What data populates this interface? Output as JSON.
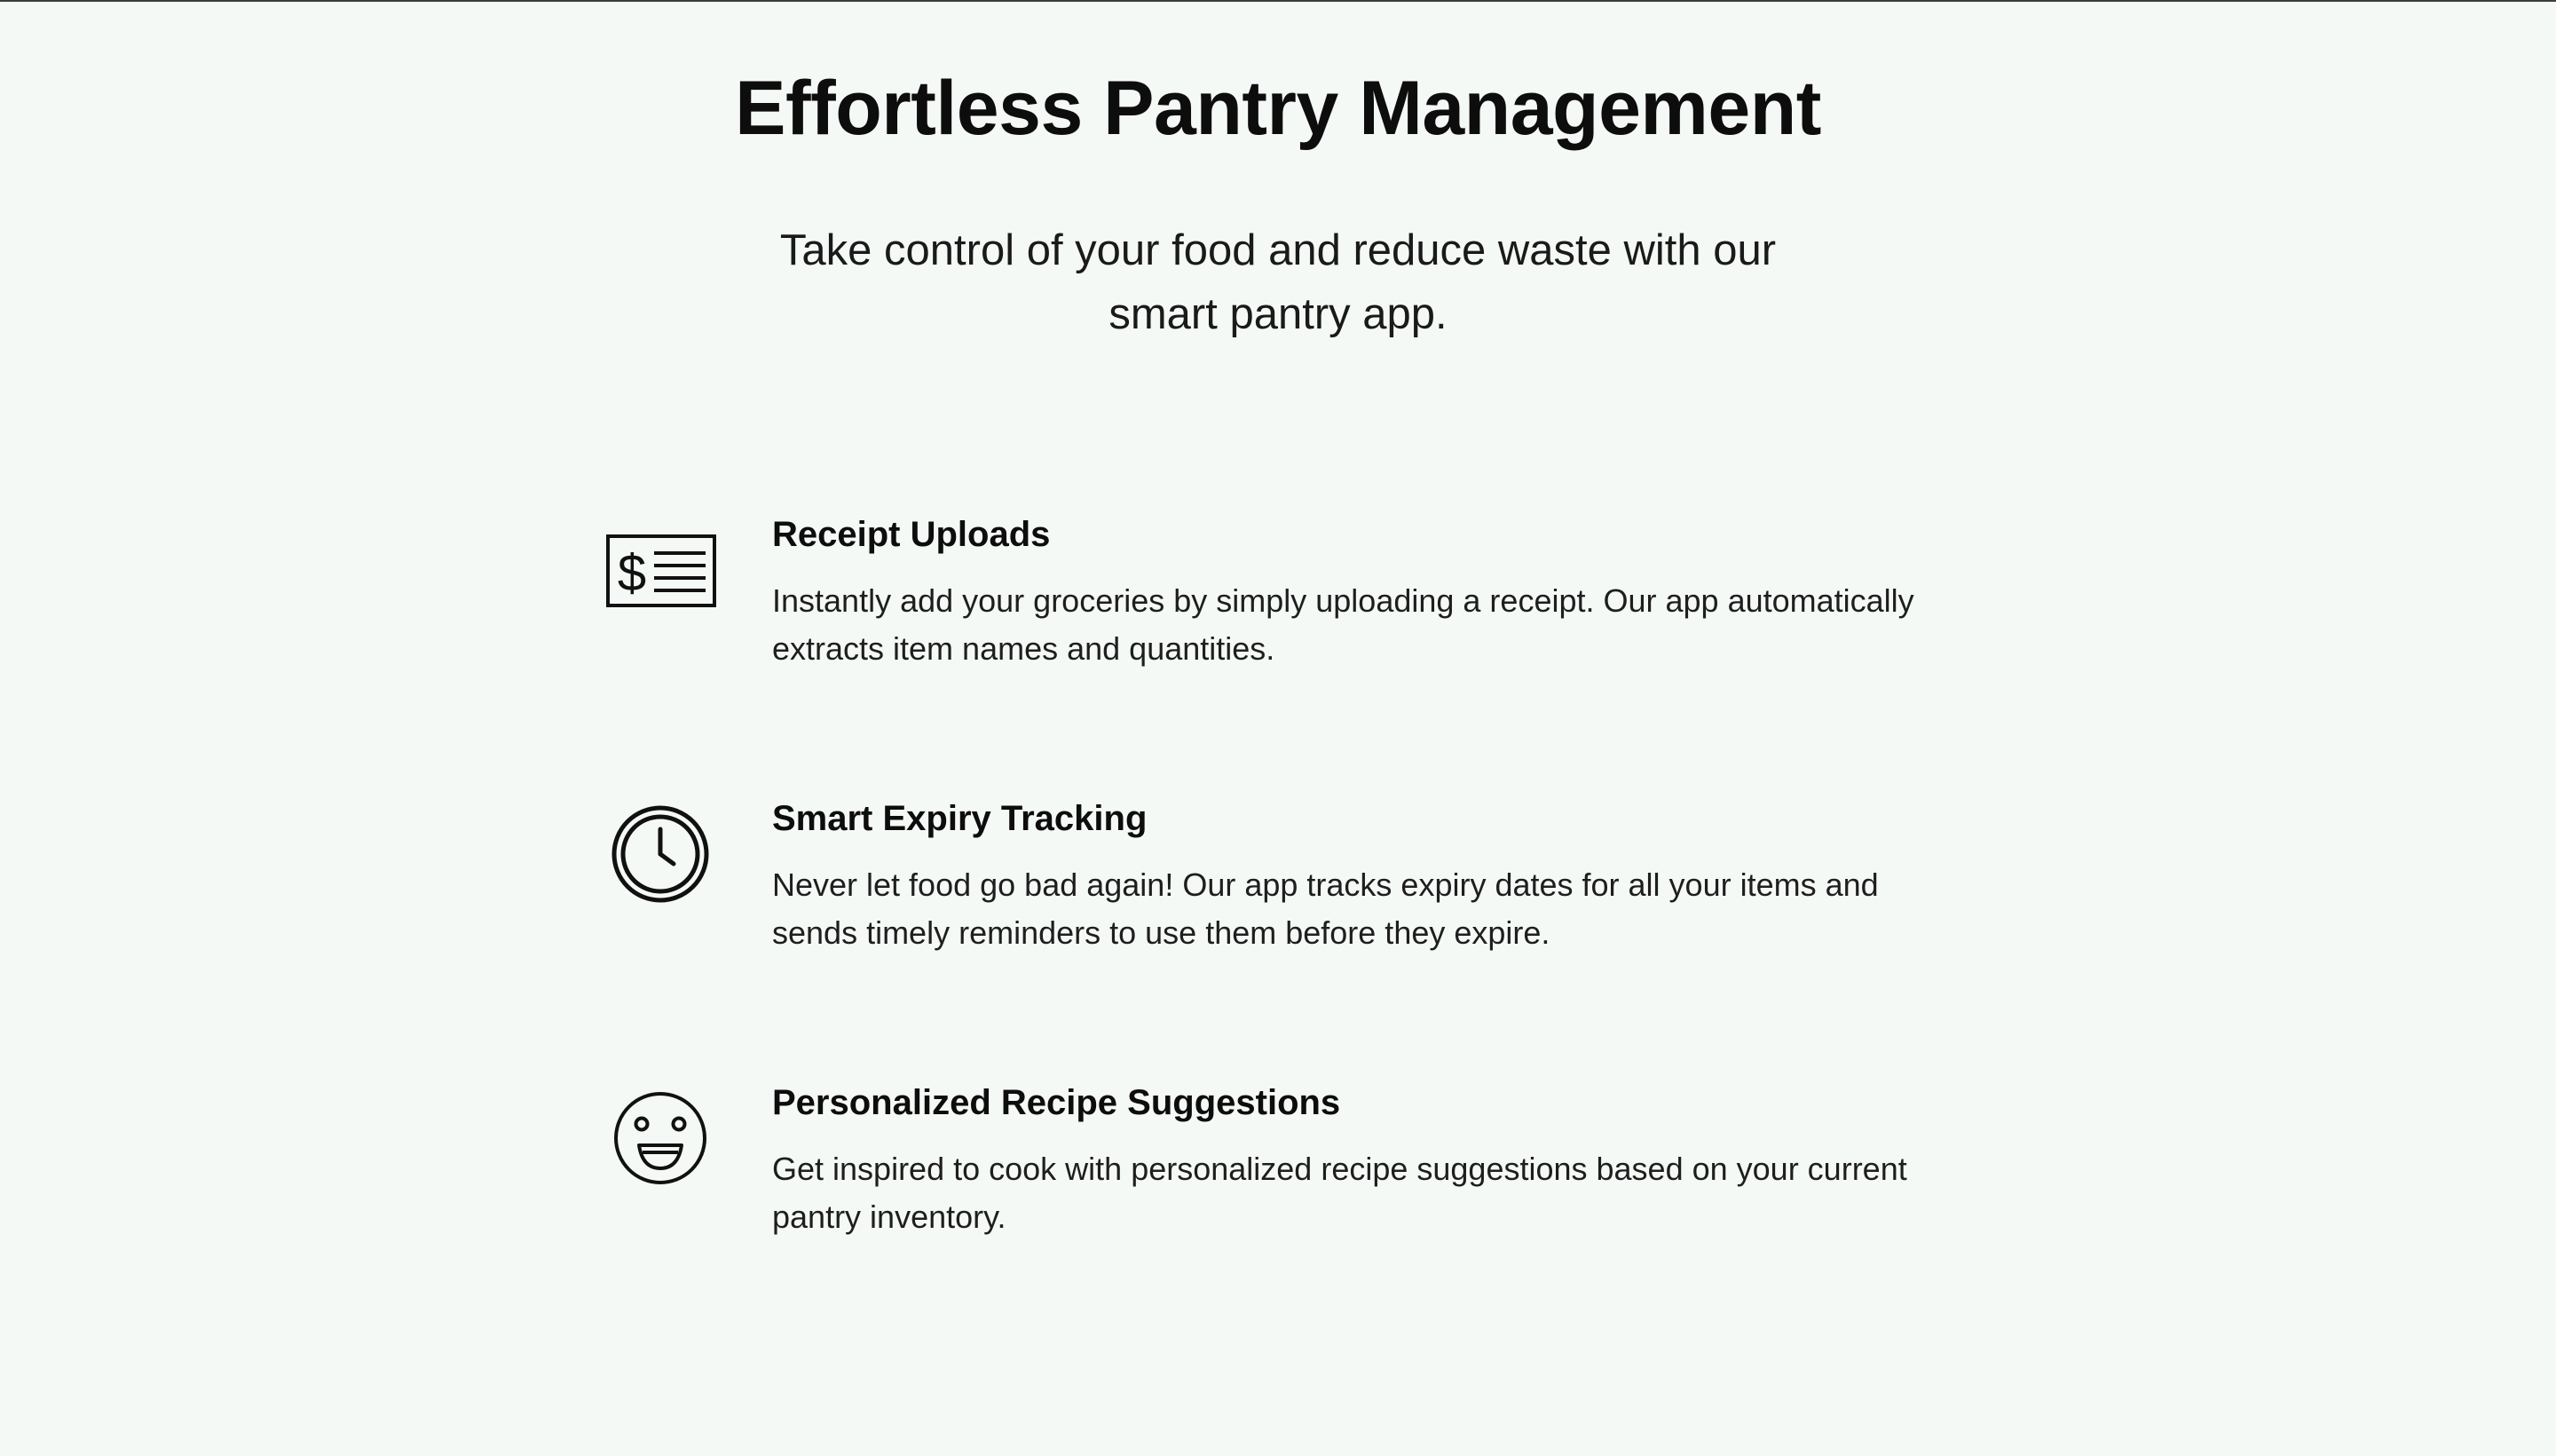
{
  "hero": {
    "title": "Effortless Pantry Management",
    "subtitle": "Take control of your food and reduce waste with our smart pantry app."
  },
  "features": [
    {
      "icon": "receipt-icon",
      "title": "Receipt Uploads",
      "description": "Instantly add your groceries by simply uploading a receipt. Our app automatically extracts item names and quantities."
    },
    {
      "icon": "clock-icon",
      "title": "Smart Expiry Tracking",
      "description": "Never let food go bad again! Our app tracks expiry dates for all your items and sends timely reminders to use them before they expire."
    },
    {
      "icon": "smiley-icon",
      "title": "Personalized Recipe Suggestions",
      "description": "Get inspired to cook with personalized recipe suggestions based on your current pantry inventory."
    }
  ],
  "colors": {
    "background": "#f5f9f6",
    "text": "#111111",
    "top_rule": "#3a3f3c"
  }
}
